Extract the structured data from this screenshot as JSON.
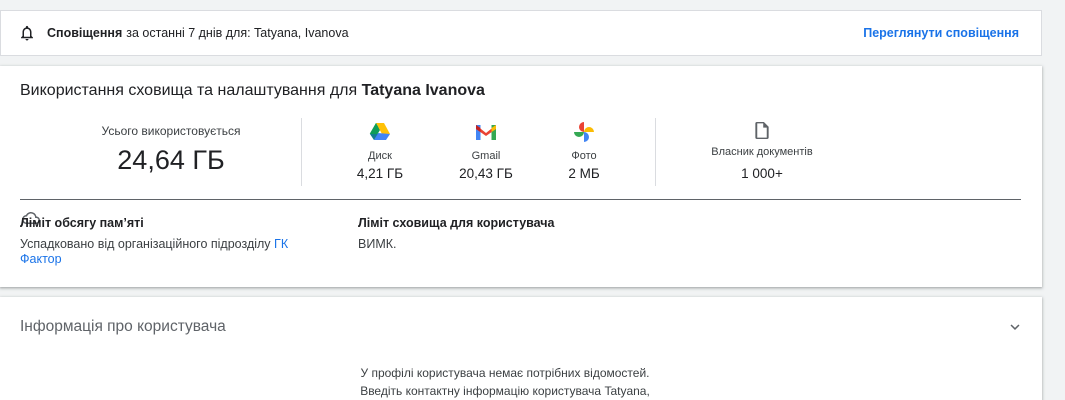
{
  "notification": {
    "icon": "bell-icon",
    "bold_label": "Сповіщення",
    "text": "за останні 7 днів для: Tatyana, Ivanova",
    "link_label": "Переглянути сповіщення",
    "link_color": "#1a73e8"
  },
  "storage": {
    "title_prefix": "Використання сховища та налаштування для",
    "title_user": "Tatyana Ivanova",
    "cloud_icon": "cloud-icon",
    "total_label": "Усього використовується",
    "total_value": "24,64 ГБ",
    "apps": [
      {
        "icon": "google-drive-icon",
        "name": "Диск",
        "value": "4,21 ГБ"
      },
      {
        "icon": "gmail-icon",
        "name": "Gmail",
        "value": "20,43 ГБ"
      },
      {
        "icon": "google-photos-icon",
        "name": "Фото",
        "value": "2 МБ"
      }
    ],
    "owner": {
      "icon": "document-icon",
      "label": "Власник документів",
      "value": "1 000+"
    },
    "memory_limit": {
      "heading": "Ліміт обсягу пам’яті",
      "text": "Успадковано від організаційного підрозділу",
      "link": "ГК Фактор"
    },
    "user_limit": {
      "heading": "Ліміт сховища для користувача",
      "value": "ВИМК."
    }
  },
  "user_info": {
    "title": "Інформація про користувача",
    "chevron_icon": "chevron-down-icon",
    "line1": "У профілі користувача немає потрібних відомостей.",
    "line2": "Введіть контактну інформацію користувача Tatyana,"
  }
}
